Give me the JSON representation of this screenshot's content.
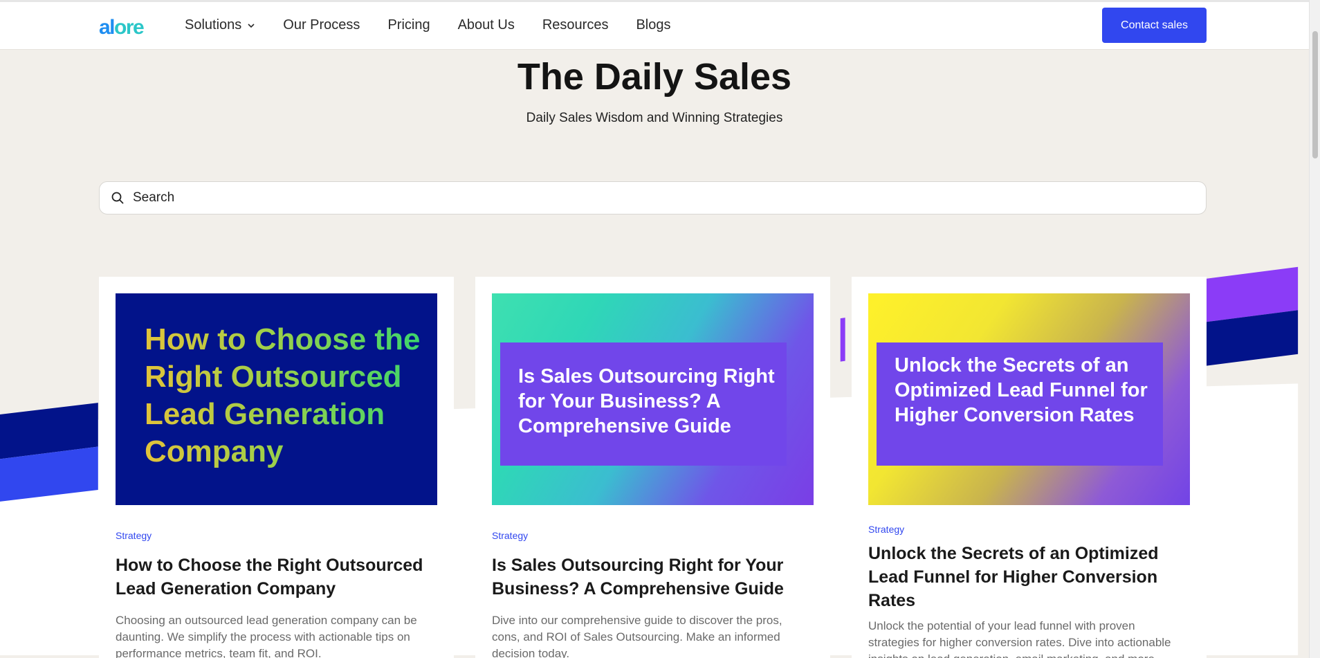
{
  "nav": {
    "logo_a": "al",
    "logo_b": "ore",
    "links": [
      {
        "label": "Solutions",
        "has_dropdown": true
      },
      {
        "label": "Our Process"
      },
      {
        "label": "Pricing"
      },
      {
        "label": "About Us"
      },
      {
        "label": "Resources"
      },
      {
        "label": "Blogs"
      }
    ],
    "cta_label": "Contact sales"
  },
  "hero": {
    "title": "The Daily Sales",
    "subtitle": "Daily Sales Wisdom and Winning Strategies"
  },
  "search": {
    "placeholder": "Search"
  },
  "cards": [
    {
      "image_title": "How to Choose the Right Outsourced Lead Generation Company",
      "category": "Strategy",
      "title": "How to Choose the Right Outsourced Lead Generation Company",
      "description": "Choosing an outsourced lead generation company can be daunting. We simplify the process with actionable tips on performance metrics, team fit, and ROI."
    },
    {
      "image_title": "Is Sales Outsourcing Right for Your Business? A Comprehensive Guide",
      "category": "Strategy",
      "title": "Is Sales Outsourcing Right for Your Business? A Comprehensive Guide",
      "description": "Dive into our comprehensive guide to discover the pros, cons, and ROI of Sales Outsourcing. Make an informed decision today."
    },
    {
      "image_title": "Unlock the Secrets of an Optimized Lead Funnel for Higher Conversion Rates",
      "category": "Strategy",
      "title": "Unlock the Secrets of an Optimized Lead Funnel for Higher Conversion Rates",
      "description": "Unlock the potential of your lead funnel with proven strategies for higher conversion rates. Dive into actionable insights on lead generation, email marketing, and more."
    }
  ],
  "colors": {
    "accent": "#3147ef",
    "page_bg": "#f2efea",
    "navy": "#02138a",
    "purple": "#8b3cf7"
  }
}
